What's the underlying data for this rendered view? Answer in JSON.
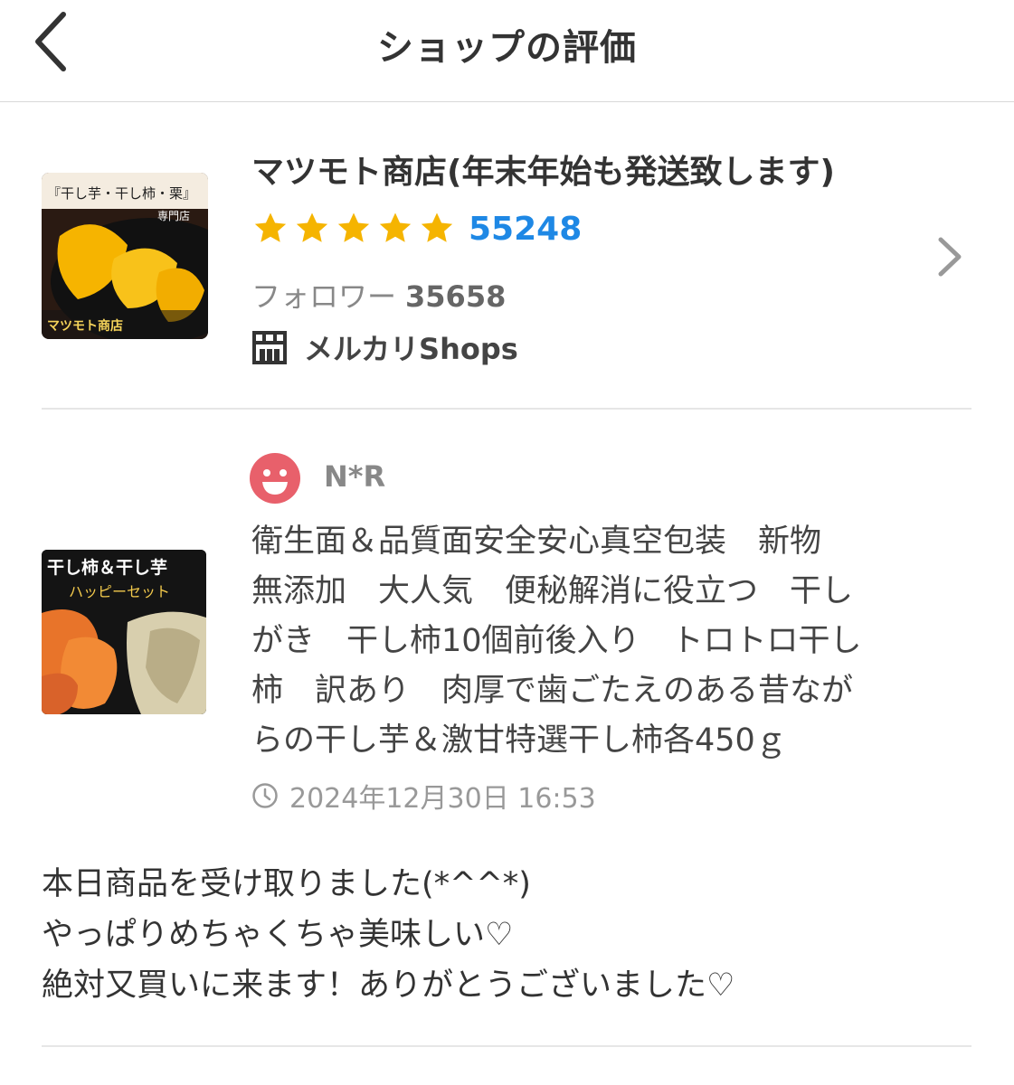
{
  "header": {
    "title": "ショップの評価"
  },
  "shop": {
    "name": "マツモト商店(年末年始も発送致します)",
    "rating_stars": 5,
    "rating_count": "55248",
    "followers_label": "フォロワー",
    "followers_count": "35658",
    "platform_label": "メルカリShops",
    "thumbnail_caption_top": "『干し芋・干し柿・栗』",
    "thumbnail_caption_sub": "専門店",
    "thumbnail_caption_bottom": "マツモト商店",
    "star_color": "#f5b400"
  },
  "review": {
    "reviewer_name": "N*R",
    "product_title_lines": [
      "衛生面＆品質面安全安心真空包装　新物",
      "無添加　大人気　便秘解消に役立つ　干し",
      "がき　干し柿10個前後入り　トロトロ干し",
      "柿　訳あり　肉厚で歯ごたえのある昔なが",
      "らの干し芋＆激甘特選干し柿各450ｇ"
    ],
    "product_thumb_caption_1": "干し柿＆干し芋",
    "product_thumb_caption_2": "ハッピーセット",
    "timestamp": "2024年12月30日 16:53",
    "body_lines": [
      "本日商品を受け取りました(*^^*)",
      "やっぱりめちゃくちゃ美味しい♡",
      "絶対又買いに来ます！ありがとうございました♡"
    ],
    "avatar_color": "#e8606b"
  },
  "colors": {
    "accent_blue": "#1e88e5",
    "divider": "#e6e6e6"
  }
}
